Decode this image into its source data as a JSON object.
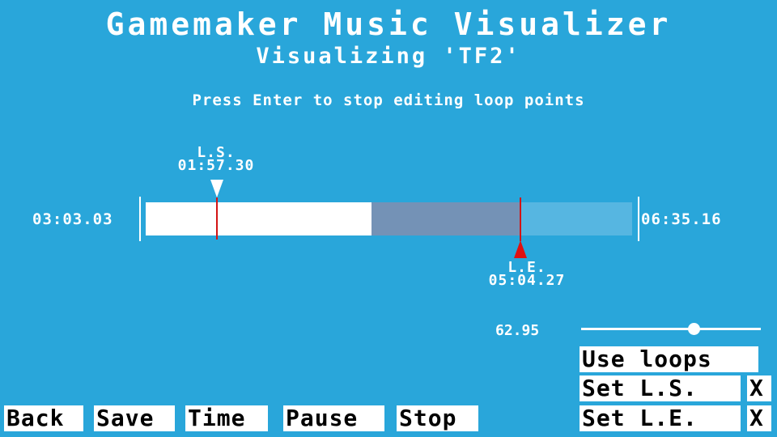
{
  "header": {
    "title": "Gamemaker Music Visualizer",
    "subtitle": "Visualizing 'TF2'",
    "instruction": "Press Enter to stop editing loop points"
  },
  "timeline": {
    "start_time": "03:03.03",
    "end_time": "06:35.16",
    "loop_start": {
      "label": "L.S.",
      "time": "01:57.30"
    },
    "loop_end": {
      "label": "L.E.",
      "time": "05:04.27"
    }
  },
  "volume": {
    "value": "62.95"
  },
  "buttons": {
    "use_loops": "Use loops",
    "set_ls": "Set L.S.",
    "set_le": "Set L.E.",
    "clear_ls": "X",
    "clear_le": "X",
    "back": "Back",
    "save": "Save",
    "time": "Time",
    "pause": "Pause",
    "stop": "Stop"
  },
  "colors": {
    "background": "#29a6da",
    "track_remaining": "#56b6e1",
    "track_played": "#ffffff",
    "loop_region": "#7492b6",
    "marker": "#d31414"
  }
}
